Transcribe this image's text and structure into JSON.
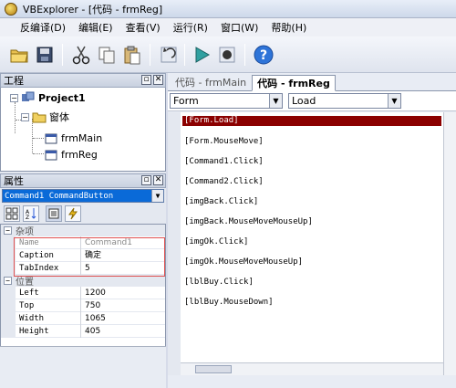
{
  "window": {
    "title": "VBExplorer - [代码 - frmReg]"
  },
  "menu": [
    "反编译(D)",
    "编辑(E)",
    "查看(V)",
    "运行(R)",
    "窗口(W)",
    "帮助(H)"
  ],
  "toolbar": {
    "icons": [
      "open-folder-icon",
      "save-icon",
      "cut-icon",
      "copy-icon",
      "paste-icon",
      "undo-icon",
      "run-icon",
      "stop-icon",
      "help-icon"
    ]
  },
  "project_panel": {
    "title": "工程",
    "root": "Project1",
    "folder": "窗体",
    "forms": [
      "frmMain",
      "frmReg"
    ]
  },
  "properties_panel": {
    "title": "属性",
    "object_selector": "Command1  CommandButton",
    "category_misc": "杂项",
    "misc_props": [
      {
        "name": "Name",
        "value": "Command1"
      },
      {
        "name": "Caption",
        "value": "确定"
      },
      {
        "name": "TabIndex",
        "value": "5"
      }
    ],
    "category_position": "位置",
    "position_props": [
      {
        "name": "Left",
        "value": "1200"
      },
      {
        "name": "Top",
        "value": "750"
      },
      {
        "name": "Width",
        "value": "1065"
      },
      {
        "name": "Height",
        "value": "405"
      }
    ]
  },
  "code_panel": {
    "tabs": [
      "代码 - frmMain",
      "代码 - frmReg"
    ],
    "active_tab": 1,
    "object_combo": "Form",
    "proc_combo": "Load",
    "lines": [
      "[Form.Load]",
      "[Form.MouseMove]",
      "[Command1.Click]",
      "[Command2.Click]",
      "[imgBack.Click]",
      "[imgBack.MouseMoveMouseUp]",
      "[imgOk.Click]",
      "[imgOk.MouseMoveMouseUp]",
      "[lblBuy.Click]",
      "[lblBuy.MouseDown]"
    ],
    "selected_line": 0
  },
  "colors": {
    "selected_line_bg": "#8b0000",
    "object_selector_bg": "#0a6ad8",
    "highlight_box": "#e05050"
  }
}
